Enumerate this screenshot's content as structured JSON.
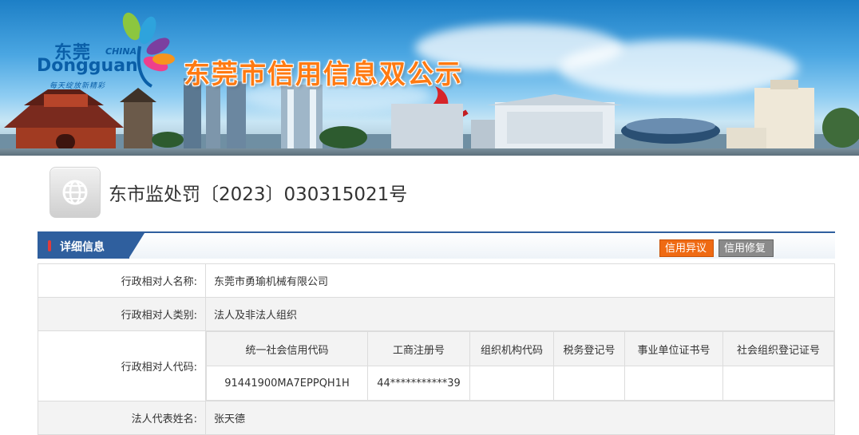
{
  "banner": {
    "logo_cn": "东莞",
    "logo_china": "CHINA",
    "logo_en": "Dongguan",
    "logo_slogan": "每天绽放新精彩",
    "site_title": "东莞市信用信息双公示"
  },
  "document": {
    "title": "东市监处罚〔2023〕030315021号",
    "icon": "globe-document-icon"
  },
  "section": {
    "tab_label": "详细信息",
    "buttons": {
      "objection": "信用异议",
      "repair": "信用修复"
    }
  },
  "colors": {
    "accent_blue": "#2f5f9e",
    "title_orange": "#ff7a12",
    "objection_orange": "#ef6a13",
    "repair_grey": "#8a8a8a"
  },
  "details": {
    "name_label": "行政相对人名称:",
    "name_value": "东莞市勇瑜机械有限公司",
    "category_label": "行政相对人类别:",
    "category_value": "法人及非法人组织",
    "code_label": "行政相对人代码:",
    "codes": {
      "headers": [
        "统一社会信用代码",
        "工商注册号",
        "组织机构代码",
        "税务登记号",
        "事业单位证书号",
        "社会组织登记证号"
      ],
      "values": [
        "91441900MA7EPPQH1H",
        "44***********39",
        "",
        "",
        "",
        ""
      ]
    },
    "legal_rep_label": "法人代表姓名:",
    "legal_rep_value": "张天德"
  }
}
